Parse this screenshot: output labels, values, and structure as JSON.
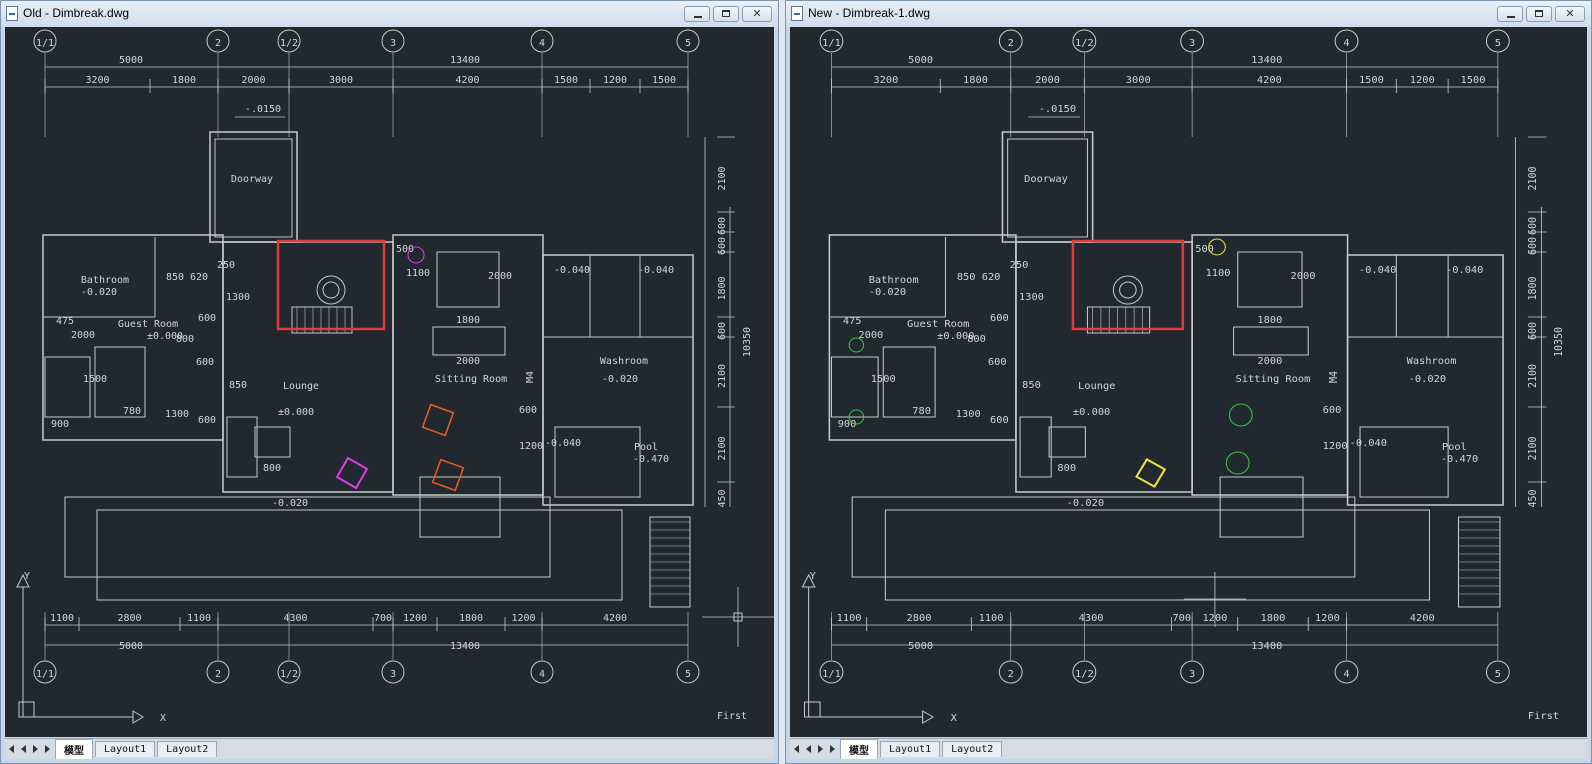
{
  "left_window": {
    "title": "Old - Dimbreak.dwg",
    "tabs": [
      "模型",
      "Layout1",
      "Layout2"
    ],
    "active_tab": "模型"
  },
  "right_window": {
    "title": "New - Dimbreak-1.dwg",
    "tabs": [
      "模型",
      "Layout1",
      "Layout2"
    ],
    "active_tab": "模型"
  },
  "drawing": {
    "grid_labels": [
      "1/1",
      "2",
      "1/2",
      "3",
      "4",
      "5"
    ],
    "top_dims_total": [
      "5000",
      "13400"
    ],
    "top_dims_detail": [
      "3200",
      "1800",
      "2000",
      "3000",
      "4200",
      "1500",
      "1200",
      "1500"
    ],
    "bottom_dims_detail": [
      "1100",
      "2800",
      "1100",
      "4300",
      "700",
      "1200",
      "1800",
      "1200",
      "4200"
    ],
    "bottom_dims_total": [
      "5000",
      "13400"
    ],
    "right_dims_detail": [
      "2100",
      "600",
      "600",
      "1800",
      "600",
      "2100",
      "2100",
      "450"
    ],
    "right_dim_total": "10350",
    "level_top": "-.0150",
    "level_bottom": "-0.020",
    "rooms": {
      "doorway": "Doorway",
      "bathroom": "Bathroom",
      "bathroom_level": "-0.020",
      "guest_room": "Guest Room",
      "guest_room_level": "±0.000",
      "lounge": "Lounge",
      "lounge_level": "±0.000",
      "sitting_room": "Sitting Room",
      "washroom": "Washroom",
      "washroom_level": "-0.020",
      "pool": "Pool",
      "pool_level": "-0.470",
      "m4": "M4"
    },
    "misc_dims": [
      "850",
      "620",
      "250",
      "1300",
      "475",
      "600",
      "800",
      "2000",
      "1500",
      "780",
      "900",
      "600",
      "1300",
      "850",
      "800",
      "600",
      "1100",
      "500",
      "1800",
      "2000",
      "2000",
      "600",
      "1200",
      "-0.040",
      "-0.040",
      "-0.040"
    ],
    "axis_x": "X",
    "axis_y": "Y",
    "view_label": "First"
  },
  "colors": {
    "canvas_bg": "#212830",
    "line": "#c8c8c8",
    "highlight_rect": "#e33a3a",
    "old_chairs": "#e85c1e",
    "old_magenta": "#e03ce0",
    "new_green": "#2ecc40",
    "new_yellow": "#e8e23a"
  }
}
